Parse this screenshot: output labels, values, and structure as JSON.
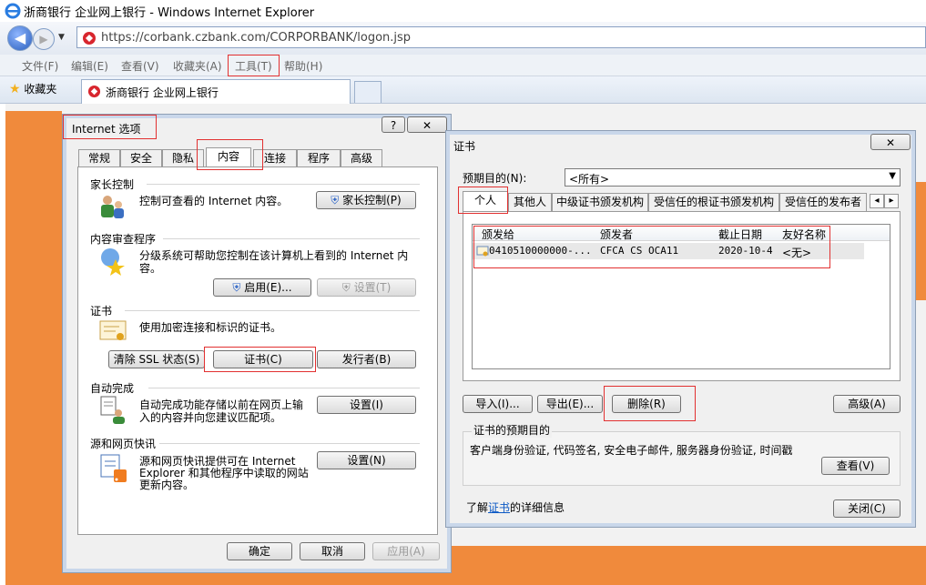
{
  "window": {
    "title": "浙商银行 企业网上银行 - Windows Internet Explorer"
  },
  "address": {
    "url": "https://corbank.czbank.com/CORPORBANK/logon.jsp"
  },
  "menu": [
    "文件(F)",
    "编辑(E)",
    "查看(V)",
    "收藏夹(A)",
    "工具(T)",
    "帮助(H)"
  ],
  "favorites": {
    "label": "收藏夹",
    "tab_title": "浙商银行 企业网上银行"
  },
  "internet_options": {
    "title": "Internet 选项",
    "tabs": [
      "常规",
      "安全",
      "隐私",
      "内容",
      "连接",
      "程序",
      "高级"
    ],
    "parental": {
      "heading": "家长控制",
      "desc": "控制可查看的 Internet 内容。",
      "button": "家长控制(P)"
    },
    "advisor": {
      "heading": "内容审查程序",
      "desc1": "分级系统可帮助您控制在该计算机上看到的 Internet 内",
      "desc2": "容。",
      "enable": "启用(E)...",
      "settings": "设置(T)"
    },
    "certs": {
      "heading": "证书",
      "desc": "使用加密连接和标识的证书。",
      "clear_ssl": "清除 SSL 状态(S)",
      "certificates": "证书(C)",
      "publishers": "发行者(B)"
    },
    "autocomplete": {
      "heading": "自动完成",
      "desc1": "自动完成功能存储以前在网页上输",
      "desc2": "入的内容并向您建议匹配项。",
      "button": "设置(I)"
    },
    "feeds": {
      "heading": "源和网页快讯",
      "desc1": "源和网页快讯提供可在 Internet",
      "desc2": "Explorer 和其他程序中读取的网站",
      "desc3": "更新内容。",
      "button": "设置(N)"
    },
    "ok": "确定",
    "cancel": "取消",
    "apply": "应用(A)",
    "help": "?",
    "close": "✕"
  },
  "certificates": {
    "title": "证书",
    "purpose_label": "预期目的(N):",
    "purpose_value": "<所有>",
    "tabs": [
      "个人",
      "其他人",
      "中级证书颁发机构",
      "受信任的根证书颁发机构",
      "受信任的发布者"
    ],
    "columns": [
      "颁发给",
      "颁发者",
      "截止日期",
      "友好名称"
    ],
    "rows": [
      {
        "issued_to": "0410510000000-...",
        "issuer": "CFCA CS OCA11",
        "expiry": "2020-10-4",
        "friendly": "<无>"
      }
    ],
    "import": "导入(I)...",
    "export": "导出(E)...",
    "remove": "删除(R)",
    "advanced": "高级(A)",
    "purposes_heading": "证书的预期目的",
    "purposes_text": "客户端身份验证, 代码签名, 安全电子邮件, 服务器身份验证, 时间戳",
    "view": "查看(V)",
    "learn_prefix": "了解",
    "learn_link": "证书",
    "learn_suffix": "的详细信息",
    "close_btn": "关闭(C)",
    "help": "?",
    "close": "✕"
  }
}
